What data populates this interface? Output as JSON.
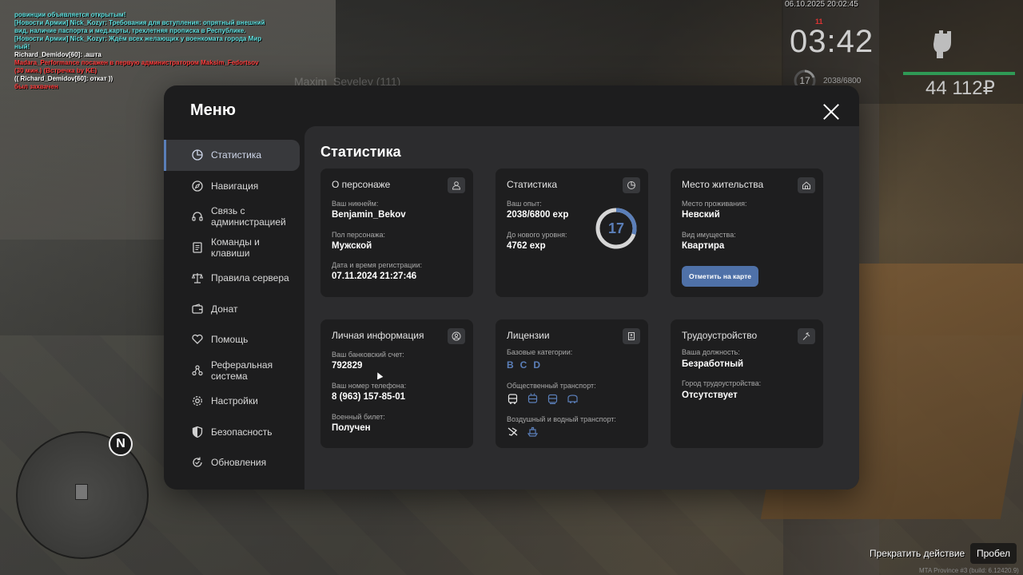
{
  "chat": [
    {
      "text": "ровинции объявляется открытым!",
      "color": "#5ee0e0"
    },
    {
      "text": "[Новости Армии] Nick_Kozyr: Требования для вступления: опрятный внешний",
      "color": "#5ee0e0"
    },
    {
      "text": " вид, наличие паспорта и мед.карты, трехлетняя прописка в Республике.",
      "color": "#5ee0e0"
    },
    {
      "text": "[Новости Армии] Nick_Kozyr: Ждём всех желающих у военкомата города Мир",
      "color": "#5ee0e0"
    },
    {
      "text": "ный!",
      "color": "#5ee0e0"
    },
    {
      "text": "Richard_Demidov[60]: .ашта",
      "color": "#ffffff"
    },
    {
      "text": "Madara_Performance посажен в первую администратором Maksim_Fedortsov",
      "color": "#ff3b3b"
    },
    {
      "text": "(30 мин.) (Встречка by KE)",
      "color": "#ff3b3b"
    },
    {
      "text": "(( Richard_Demidov[60]: откат ))",
      "color": "#ffffff"
    },
    {
      "text": "  был захвачен",
      "color": "#ff3b3b"
    }
  ],
  "player_tag": "Maxim_Seveley (111)",
  "hud": {
    "datetime": "06.10.2025 20:02:45",
    "alert": "11",
    "time": "03:42",
    "level": "17",
    "exp": "2038/6800",
    "money": "44 112₽"
  },
  "minimap": {
    "north": "N"
  },
  "prompts": {
    "action": "Прекратить действие",
    "key": "Пробел",
    "build": "MTA Province #3 (build: 6.12420.9)"
  },
  "menu": {
    "title": "Меню",
    "nav": [
      {
        "label": "Статистика",
        "icon": "pie-chart-icon",
        "active": true
      },
      {
        "label": "Навигация",
        "icon": "compass-icon",
        "active": false
      },
      {
        "label": "Связь с\nадминистрацией",
        "icon": "headset-icon",
        "active": false
      },
      {
        "label": "Команды и\nклавиши",
        "icon": "document-icon",
        "active": false
      },
      {
        "label": "Правила сервера",
        "icon": "scales-icon",
        "active": false
      },
      {
        "label": "Донат",
        "icon": "wallet-icon",
        "active": false
      },
      {
        "label": "Помощь",
        "icon": "heart-hands-icon",
        "active": false
      },
      {
        "label": "Реферальная\nсистема",
        "icon": "referral-icon",
        "active": false
      },
      {
        "label": "Настройки",
        "icon": "gear-icon",
        "active": false
      },
      {
        "label": "Безопасность",
        "icon": "shield-icon",
        "active": false
      },
      {
        "label": "Обновления",
        "icon": "update-icon",
        "active": false
      }
    ]
  },
  "stats": {
    "title": "Статистика",
    "character": {
      "title": "О персонаже",
      "nickname_label": "Ваш никнейм:",
      "nickname": "Benjamin_Bekov",
      "gender_label": "Пол персонажа:",
      "gender": "Мужской",
      "reg_label": "Дата и время регистрации:",
      "reg": "07.11.2024 21:27:46"
    },
    "statistics": {
      "title": "Статистика",
      "exp_label": "Ваш опыт:",
      "exp": "2038/6800 exp",
      "next_label": "До нового уровня:",
      "next": "4762 exp",
      "level": "17",
      "progress": 0.2997
    },
    "residence": {
      "title": "Место жительства",
      "place_label": "Место проживания:",
      "place": "Невский",
      "type_label": "Вид имущества:",
      "type": "Квартира",
      "button": "Отметить на карте"
    },
    "personal": {
      "title": "Личная информация",
      "bank_label": "Ваш банковский счет:",
      "bank": "792829",
      "phone_label": "Ваш номер телефона:",
      "phone": "8 (963) 157-85-01",
      "military_label": "Военный билет:",
      "military": "Получен"
    },
    "licenses": {
      "title": "Лицензии",
      "base_label": "Базовые категории:",
      "categories": [
        "B",
        "C",
        "D"
      ],
      "public_label": "Общественный транспорт:",
      "air_label": "Воздушный и водный транспорт:"
    },
    "employment": {
      "title": "Трудоустройство",
      "position_label": "Ваша должность:",
      "position": "Безработный",
      "city_label": "Город трудоустройства:",
      "city": "Отсутствует"
    }
  },
  "colors": {
    "accent": "#5b7fb9",
    "button": "#4f71a8",
    "hud_bar": "#2f9a55"
  }
}
